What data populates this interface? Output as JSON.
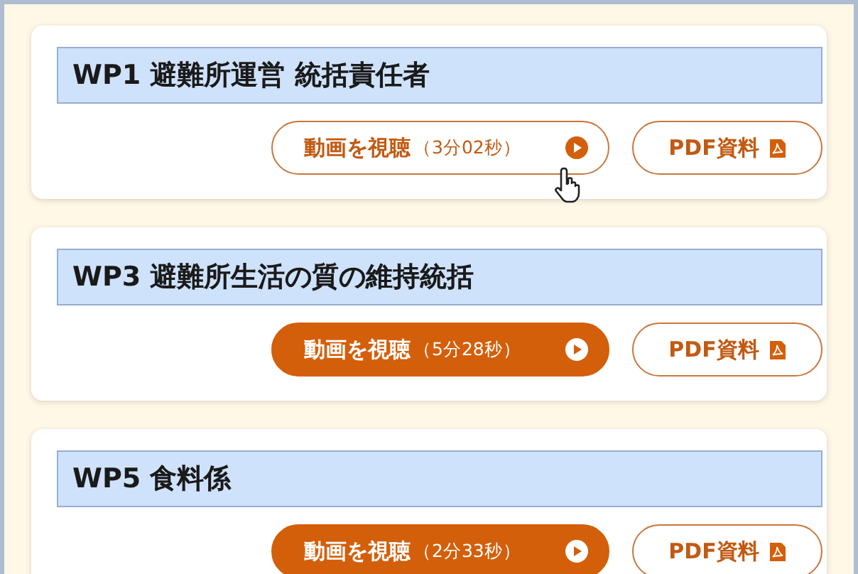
{
  "cards": [
    {
      "title": "WP1 避難所運営 統括責任者",
      "video": {
        "label": "動画を視聴",
        "duration": "（3分02秒）",
        "hovered": true
      },
      "pdf": {
        "label": "PDF資料"
      }
    },
    {
      "title": "WP3 避難所生活の質の維持統括",
      "video": {
        "label": "動画を視聴",
        "duration": "（5分28秒）",
        "hovered": false
      },
      "pdf": {
        "label": "PDF資料"
      }
    },
    {
      "title": "WP5 食料係",
      "video": {
        "label": "動画を視聴",
        "duration": "（2分33秒）",
        "hovered": false
      },
      "pdf": {
        "label": "PDF資料"
      }
    }
  ]
}
